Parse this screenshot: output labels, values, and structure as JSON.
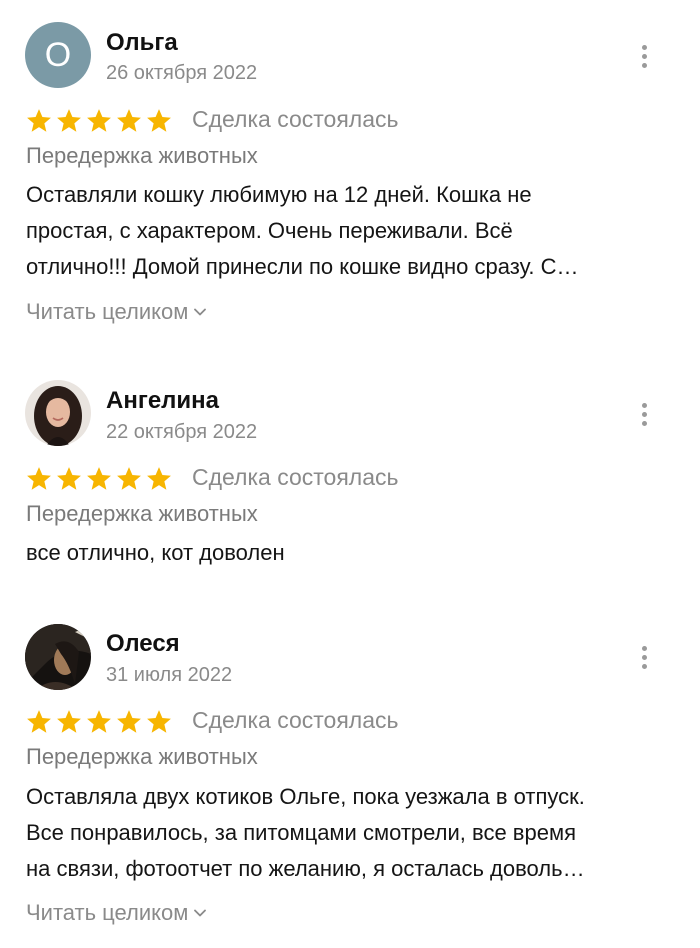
{
  "colors": {
    "star": "#f7b500",
    "muted": "#8a8a8a",
    "avatar_bg": "#7b9aa6"
  },
  "reviews": [
    {
      "avatar_letter": "О",
      "name": "Ольга",
      "date": "26 октября 2022",
      "rating": 5,
      "deal_status": "Сделка состоялась",
      "category": "Передержка животных",
      "text_lines": [
        "Оставляли кошку любимую на 12 дней. Кошка не",
        "простая, с характером. Очень переживали. Всё",
        "отлично!!! Домой принесли по кошке видно сразу. С…"
      ],
      "read_more": "Читать целиком"
    },
    {
      "name": "Ангелина",
      "date": "22 октября 2022",
      "rating": 5,
      "deal_status": "Сделка состоялась",
      "category": "Передержка животных",
      "text_lines": [
        "все отлично, кот доволен"
      ]
    },
    {
      "name": "Олеся",
      "date": "31 июля 2022",
      "rating": 5,
      "deal_status": "Сделка состоялась",
      "category": "Передержка животных",
      "text_lines": [
        "Оставляла двух котиков Ольге, пока уезжала в отпуск.",
        "Все понравилось, за питомцами смотрели, все время",
        "на связи, фотоотчет по желанию, я осталась доволь…"
      ],
      "read_more": "Читать целиком"
    }
  ]
}
